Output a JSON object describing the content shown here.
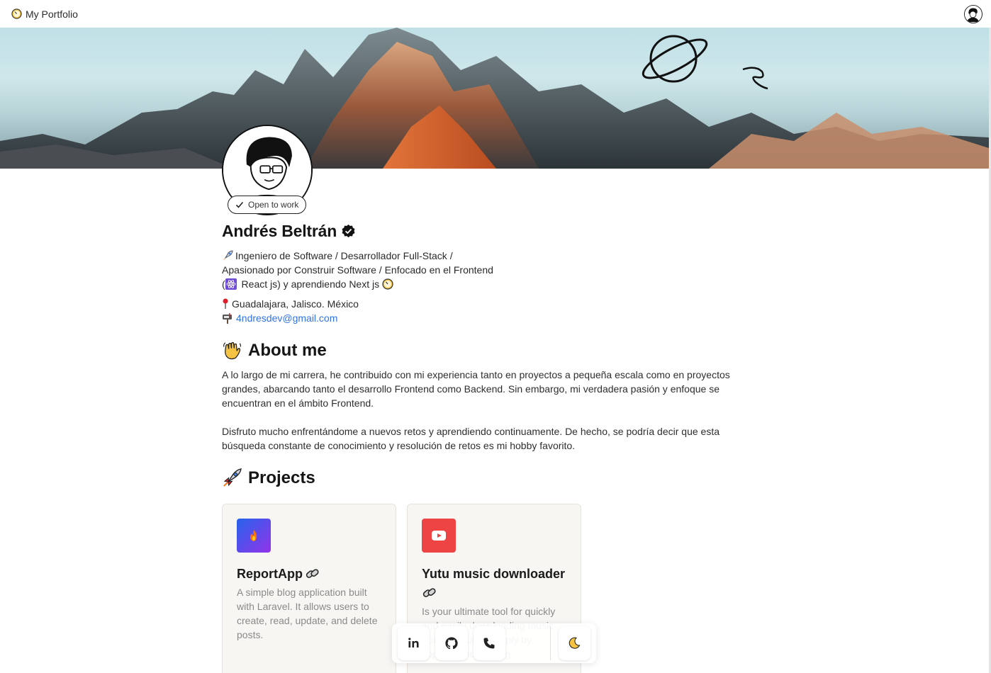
{
  "nav": {
    "brand": "My Portfolio",
    "brand_icon": "clock-icon",
    "avatar_icon": "user-avatar-icon"
  },
  "profile": {
    "name": "Andrés Beltrán",
    "badge": "Open to work",
    "bio_lines": [
      "Ingeniero de Software / Desarrollador Full-Stack /",
      "Apasionado por Construir Software / Enfocado en el Frontend",
      "(",
      " React js) y aprendiendo Next js "
    ],
    "location": "Guadalajara, Jalisco. México",
    "email": "4ndresdev@gmail.com"
  },
  "about": {
    "title": "About me",
    "paragraphs": [
      "A lo largo de mi carrera, he contribuido con mi experiencia tanto en proyectos a pequeña escala como en proyectos grandes, abarcando tanto el desarrollo Frontend como Backend. Sin embargo, mi verdadera pasión y enfoque se encuentran en el ámbito Frontend.",
      "Disfruto mucho enfrentándome a nuevos retos y aprendiendo continuamente. De hecho, se podría decir que esta búsqueda constante de conocimiento y resolución de retos es mi hobby favorito."
    ]
  },
  "projects": {
    "title": "Projects",
    "items": [
      {
        "title": "ReportApp",
        "description": "A simple blog application built with Laravel. It allows users to create, read, update, and delete posts.",
        "icon": "fire-icon",
        "color": "#7b3cf0"
      },
      {
        "title": "Yutu music downloader",
        "description": "Is your ultimate tool for quickly and easily downloading music from YouTube. Simply by copying and clicking",
        "icon": "youtube-icon",
        "color": "#ef4444"
      }
    ]
  },
  "dock": {
    "items": [
      "linkedin-icon",
      "github-icon",
      "phone-icon",
      "moon-icon"
    ]
  },
  "colors": {
    "link": "#2f72e3",
    "card_bg": "#f8f6f3",
    "muted_text": "#8a8a8a"
  }
}
